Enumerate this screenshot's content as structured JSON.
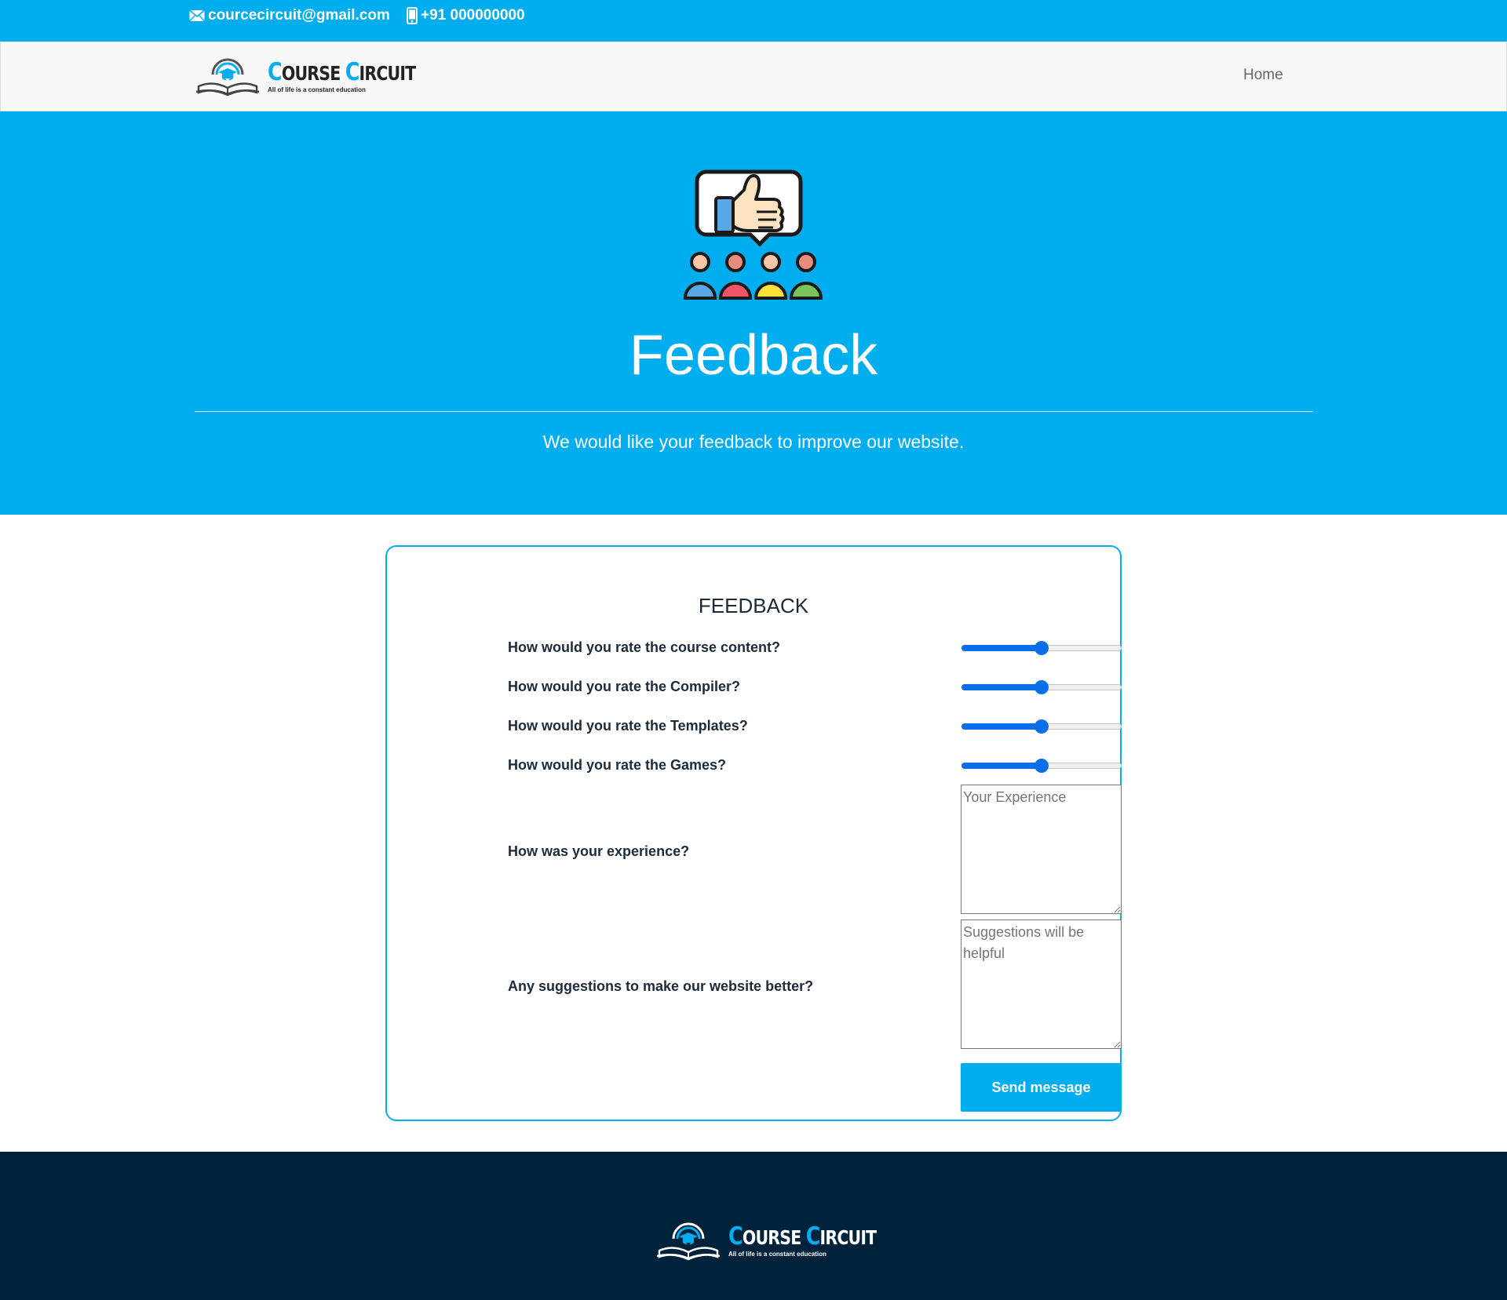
{
  "topbar": {
    "email": "courcecircuit@gmail.com",
    "phone": "+91 000000000",
    "email_icon": "envelope-icon",
    "phone_icon": "mobile-phone-icon"
  },
  "brand": {
    "name_first_cap": "C",
    "name_first_rest": "OURSE",
    "name_second_cap": "C",
    "name_second_rest": "IRCUIT",
    "tagline": "All of life is a constant education",
    "logo_icon": "graduation-book-icon"
  },
  "nav": {
    "home": "Home"
  },
  "hero": {
    "title": "Feedback",
    "subtitle": "We would like your feedback to improve our website.",
    "illustration": "thumbs-up-audience-icon"
  },
  "form": {
    "title": "FEEDBACK",
    "ratings": [
      {
        "label": "How would you rate the course content?",
        "value": 50,
        "min": 0,
        "max": 100
      },
      {
        "label": "How would you rate the Compiler?",
        "value": 50,
        "min": 0,
        "max": 100
      },
      {
        "label": "How would you rate the Templates?",
        "value": 50,
        "min": 0,
        "max": 100
      },
      {
        "label": "How would you rate the Games?",
        "value": 50,
        "min": 0,
        "max": 100
      }
    ],
    "experience": {
      "label": "How was your experience?",
      "placeholder": "Your Experience"
    },
    "suggestions": {
      "label": "Any suggestions to make our website better?",
      "placeholder": "Suggestions will be helpful"
    },
    "submit_label": "Send message"
  },
  "colors": {
    "brand_blue": "#00adee",
    "slider_blue": "#0a6ee8",
    "footer_navy": "#00223a",
    "text_dark": "#1c2a3a"
  }
}
